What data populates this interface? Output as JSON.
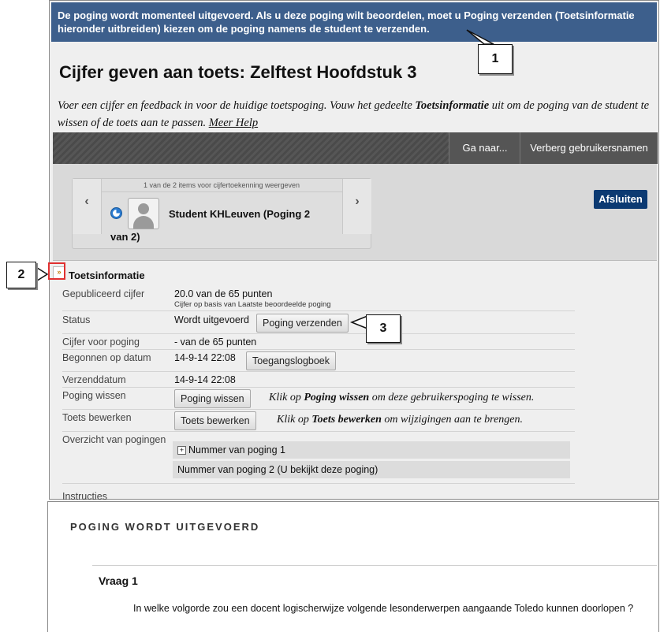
{
  "banner": {
    "text": "De poging wordt momenteel uitgevoerd. Als u deze poging wilt beoordelen, moet u Poging verzenden (Toetsinformatie hieronder uitbreiden) kiezen om de poging namens de student te verzenden."
  },
  "page": {
    "title": "Cijfer geven aan toets: Zelftest Hoofdstuk 3",
    "intro_a": "Voer een cijfer en feedback in voor de huidige toetspoging. Vouw het gedeelte ",
    "intro_b": "Toetsinformatie",
    "intro_c": " uit om de poging van de student te wissen of de toets aan te passen. ",
    "intro_link": "Meer Help"
  },
  "toolbar": {
    "goto": "Ga naar...",
    "hide_users": "Verberg gebruikersnamen"
  },
  "nav": {
    "count": "1 van de 2 items voor cijfertoekenning weergeven",
    "prev": "‹",
    "next": "›",
    "student_line1": "Student KHLeuven (Poging 2",
    "student_line2": "van 2)",
    "close": "Afsluiten"
  },
  "info": {
    "section_title": "Toetsinformatie",
    "collapse_glyph": "»",
    "rows": {
      "published_label": "Gepubliceerd cijfer",
      "published_value": "20.0 van de 65 punten",
      "published_sub": "Cijfer op basis van Laatste beoordeelde poging",
      "status_label": "Status",
      "status_value": "Wordt uitgevoerd",
      "submit_btn": "Poging verzenden",
      "attempt_grade_label": "Cijfer voor poging",
      "attempt_grade_value": "- van de 65 punten",
      "started_label": "Begonnen op datum",
      "started_value": "14-9-14 22:08",
      "access_log_btn": "Toegangslogboek",
      "sent_label": "Verzenddatum",
      "sent_value": "14-9-14 22:08",
      "clear_label": "Poging wissen",
      "clear_btn": "Poging wissen",
      "clear_hint_a": "Klik op ",
      "clear_hint_b": "Poging wissen",
      "clear_hint_c": " om deze gebruikerspoging te wissen.",
      "edit_label": "Toets bewerken",
      "edit_btn": "Toets bewerken",
      "edit_hint_a": "Klik op ",
      "edit_hint_b": "Toets bewerken",
      "edit_hint_c": " om wijzigingen aan te brengen.",
      "overview_label": "Overzicht van pogingen",
      "attempt1_plus": "+",
      "attempt1": "Nummer van poging 1",
      "attempt2": "Nummer van poging 2 (U bekijkt deze poging)",
      "instructions_label": "Instructies"
    }
  },
  "attempt": {
    "heading": "POGING WORDT UITGEVOERD",
    "question_title": "Vraag 1",
    "question_text": "In welke volgorde zou een docent logischerwijze volgende lesonderwerpen aangaande Toledo kunnen doorlopen ?"
  },
  "callouts": {
    "one": "1",
    "two": "2",
    "three": "3"
  },
  "colors": {
    "banner": "#3d5f8c",
    "close_button": "#0c3a72",
    "callout_highlight": "#e03030"
  }
}
